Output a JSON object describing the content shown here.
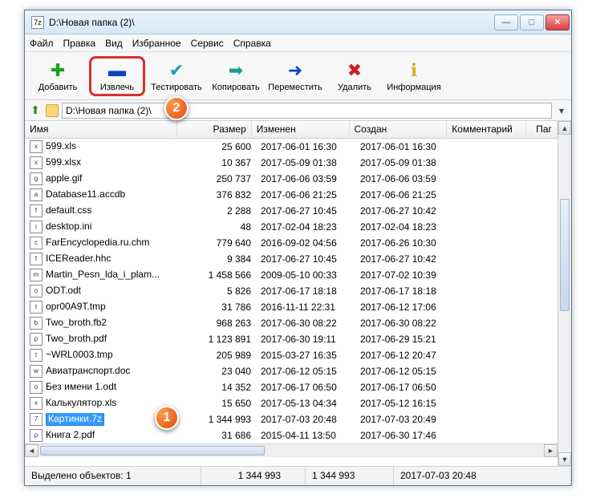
{
  "window": {
    "title": "D:\\Новая папка (2)\\"
  },
  "menu": {
    "file": "Файл",
    "edit": "Правка",
    "view": "Вид",
    "favorites": "Избранное",
    "tools": "Сервис",
    "help": "Справка"
  },
  "toolbar": {
    "add": "Добавить",
    "extract": "Извлечь",
    "test": "Тестировать",
    "copy": "Копировать",
    "move": "Переместить",
    "delete": "Удалить",
    "info": "Информация"
  },
  "path": {
    "value": "D:\\Новая папка (2)\\"
  },
  "columns": {
    "name": "Имя",
    "size": "Размер",
    "modified": "Изменен",
    "created": "Создан",
    "comment": "Комментарий",
    "folder": "Паг"
  },
  "files": [
    {
      "icon": "x",
      "name": "599.xls",
      "size": "25 600",
      "modified": "2017-06-01 16:30",
      "created": "2017-06-01 16:30"
    },
    {
      "icon": "x",
      "name": "599.xlsx",
      "size": "10 367",
      "modified": "2017-05-09 01:38",
      "created": "2017-05-09 01:38"
    },
    {
      "icon": "g",
      "name": "apple.gif",
      "size": "250 737",
      "modified": "2017-06-06 03:59",
      "created": "2017-06-06 03:59"
    },
    {
      "icon": "a",
      "name": "Database11.accdb",
      "size": "376 832",
      "modified": "2017-06-06 21:25",
      "created": "2017-06-06 21:25"
    },
    {
      "icon": "f",
      "name": "default.css",
      "size": "2 288",
      "modified": "2017-06-27 10:45",
      "created": "2017-06-27 10:42"
    },
    {
      "icon": "i",
      "name": "desktop.ini",
      "size": "48",
      "modified": "2017-02-04 18:23",
      "created": "2017-02-04 18:23"
    },
    {
      "icon": "c",
      "name": "FarEncyclopedia.ru.chm",
      "size": "779 640",
      "modified": "2016-09-02 04:56",
      "created": "2017-06-26 10:30"
    },
    {
      "icon": "f",
      "name": "ICEReader.hhc",
      "size": "9 384",
      "modified": "2017-06-27 10:45",
      "created": "2017-06-27 10:42"
    },
    {
      "icon": "m",
      "name": "Martin_Pesn_lda_i_plam...",
      "size": "1 458 566",
      "modified": "2009-05-10 00:33",
      "created": "2017-07-02 10:39"
    },
    {
      "icon": "o",
      "name": "ODT.odt",
      "size": "5 826",
      "modified": "2017-06-17 18:18",
      "created": "2017-06-17 18:18"
    },
    {
      "icon": "t",
      "name": "opr00A9T.tmp",
      "size": "31 786",
      "modified": "2016-11-11 22:31",
      "created": "2017-06-12 17:06"
    },
    {
      "icon": "b",
      "name": "Two_broth.fb2",
      "size": "968 263",
      "modified": "2017-06-30 08:22",
      "created": "2017-06-30 08:22"
    },
    {
      "icon": "p",
      "name": "Two_broth.pdf",
      "size": "1 123 891",
      "modified": "2017-06-30 19:11",
      "created": "2017-06-29 15:21"
    },
    {
      "icon": "t",
      "name": "~WRL0003.tmp",
      "size": "205 989",
      "modified": "2015-03-27 16:35",
      "created": "2017-06-12 20:47"
    },
    {
      "icon": "w",
      "name": "Авиатранспорт.doc",
      "size": "23 040",
      "modified": "2017-06-12 05:15",
      "created": "2017-06-12 05:15"
    },
    {
      "icon": "o",
      "name": "Без имени 1.odt",
      "size": "14 352",
      "modified": "2017-06-17 06:50",
      "created": "2017-06-17 06:50"
    },
    {
      "icon": "x",
      "name": "Калькулятор.xls",
      "size": "15 650",
      "modified": "2017-05-13 04:34",
      "created": "2017-05-12 16:15"
    },
    {
      "icon": "7",
      "name": "Картинки.7z",
      "size": "1 344 993",
      "modified": "2017-07-03 20:48",
      "created": "2017-07-03 20:49",
      "selected": true
    },
    {
      "icon": "p",
      "name": "Книга 2.pdf",
      "size": "31 686",
      "modified": "2015-04-11 13:50",
      "created": "2017-06-30 17:46"
    }
  ],
  "status": {
    "selected_label": "Выделено объектов: 1",
    "size1": "1 344 993",
    "size2": "1 344 993",
    "date": "2017-07-03 20:48"
  },
  "callouts": {
    "one": "1",
    "two": "2"
  }
}
